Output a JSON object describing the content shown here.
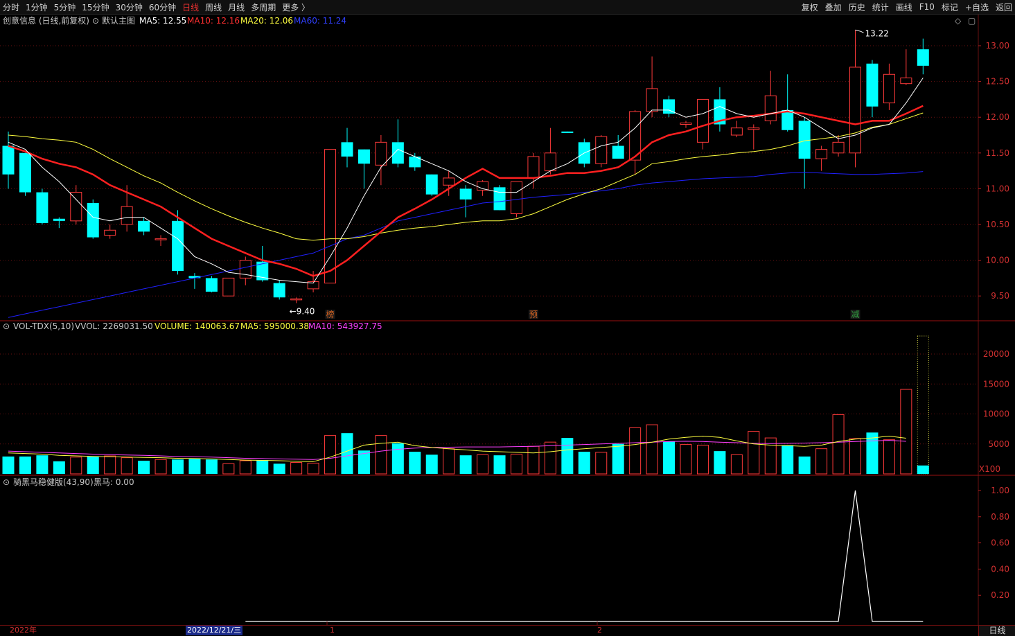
{
  "toolbar": {
    "period_tabs": [
      "分时",
      "1分钟",
      "5分钟",
      "15分钟",
      "30分钟",
      "60分钟",
      "日线",
      "周线",
      "月线",
      "多周期",
      "更多 〉"
    ],
    "active_index": 6,
    "tools": [
      "复权",
      "叠加",
      "历史",
      "统计",
      "画线",
      "F10",
      "标记",
      "+自选",
      "返回"
    ]
  },
  "main_panel": {
    "title": "创意信息 (日线,前复权)",
    "indicator": "默认主图",
    "ma5": "MA5: 12.55",
    "ma10": "MA10: 12.16",
    "ma20": "MA20: 12.06",
    "ma60": "MA60: 11.24",
    "high_label": "13.22",
    "low_label": "9.40",
    "price_ticks": [
      "13.00",
      "12.50",
      "12.00",
      "11.50",
      "11.00",
      "10.50",
      "10.00",
      "9.50"
    ],
    "markers": [
      {
        "text": "榜",
        "color": "#d06020"
      },
      {
        "text": "预",
        "color": "#d06020"
      },
      {
        "text": "减",
        "color": "#30a040"
      }
    ]
  },
  "volume_panel": {
    "title": "VOL-TDX(5,10)",
    "vvol": "VVOL: 2269031.50",
    "volume": "VOLUME: 140063.67",
    "ma5": "MA5: 595000.38",
    "ma10": "MA10: 543927.75",
    "ticks": [
      "20000",
      "15000",
      "10000",
      "5000"
    ],
    "unit": "X100"
  },
  "indicator_panel": {
    "title": "骑黑马稳健版(43,90)",
    "value": "黑马: 0.00",
    "ticks": [
      "1.00",
      "0.80",
      "0.60",
      "0.40",
      "0.20"
    ]
  },
  "bottom_axis": {
    "year": "2022年",
    "cursor_date": "2022/12/21/三",
    "month1": "1",
    "month2": "2",
    "period_button": "日线"
  },
  "colors": {
    "up": "#ff3a3a",
    "down": "#00ffff",
    "ma5": "#ffffff",
    "ma10": "#ff2020",
    "ma20": "#ffff40",
    "ma60": "#2020ff",
    "vol_ma10": "#ff40ff",
    "grid": "#6a1010"
  },
  "chart_data": {
    "type": "candlestick",
    "candles": [
      {
        "o": 11.6,
        "h": 11.8,
        "l": 11.0,
        "c": 11.2
      },
      {
        "o": 11.5,
        "h": 11.5,
        "l": 10.9,
        "c": 10.95
      },
      {
        "o": 10.95,
        "h": 11.0,
        "l": 10.5,
        "c": 10.52
      },
      {
        "o": 10.58,
        "h": 10.6,
        "l": 10.45,
        "c": 10.55
      },
      {
        "o": 10.55,
        "h": 11.05,
        "l": 10.5,
        "c": 10.95
      },
      {
        "o": 10.8,
        "h": 10.85,
        "l": 10.3,
        "c": 10.32
      },
      {
        "o": 10.35,
        "h": 10.5,
        "l": 10.3,
        "c": 10.42
      },
      {
        "o": 10.5,
        "h": 11.05,
        "l": 10.4,
        "c": 10.75
      },
      {
        "o": 10.55,
        "h": 10.6,
        "l": 10.35,
        "c": 10.4
      },
      {
        "o": 10.3,
        "h": 10.35,
        "l": 10.2,
        "c": 10.3
      },
      {
        "o": 10.55,
        "h": 10.7,
        "l": 9.8,
        "c": 9.85
      },
      {
        "o": 9.78,
        "h": 9.82,
        "l": 9.6,
        "c": 9.75
      },
      {
        "o": 9.75,
        "h": 9.78,
        "l": 9.55,
        "c": 9.56
      },
      {
        "o": 9.5,
        "h": 9.75,
        "l": 9.5,
        "c": 9.75
      },
      {
        "o": 9.75,
        "h": 10.05,
        "l": 9.65,
        "c": 10.0
      },
      {
        "o": 9.98,
        "h": 10.2,
        "l": 9.7,
        "c": 9.72
      },
      {
        "o": 9.68,
        "h": 9.72,
        "l": 9.45,
        "c": 9.48
      },
      {
        "o": 9.46,
        "h": 9.48,
        "l": 9.4,
        "c": 9.46
      },
      {
        "o": 9.6,
        "h": 9.85,
        "l": 9.55,
        "c": 9.7
      },
      {
        "o": 9.68,
        "h": 11.55,
        "l": 9.68,
        "c": 11.55
      },
      {
        "o": 11.65,
        "h": 11.85,
        "l": 11.3,
        "c": 11.45
      },
      {
        "o": 11.55,
        "h": 11.55,
        "l": 11.0,
        "c": 11.35
      },
      {
        "o": 11.33,
        "h": 11.75,
        "l": 11.05,
        "c": 11.65
      },
      {
        "o": 11.65,
        "h": 11.97,
        "l": 11.3,
        "c": 11.35
      },
      {
        "o": 11.45,
        "h": 11.5,
        "l": 11.25,
        "c": 11.3
      },
      {
        "o": 11.2,
        "h": 11.2,
        "l": 10.9,
        "c": 10.92
      },
      {
        "o": 11.05,
        "h": 11.25,
        "l": 10.9,
        "c": 11.15
      },
      {
        "o": 11.0,
        "h": 11.05,
        "l": 10.6,
        "c": 10.85
      },
      {
        "o": 10.98,
        "h": 11.12,
        "l": 10.9,
        "c": 11.1
      },
      {
        "o": 11.02,
        "h": 11.05,
        "l": 10.7,
        "c": 10.7
      },
      {
        "o": 10.65,
        "h": 11.1,
        "l": 10.6,
        "c": 11.1
      },
      {
        "o": 11.15,
        "h": 11.5,
        "l": 11.0,
        "c": 11.45
      },
      {
        "o": 11.25,
        "h": 11.85,
        "l": 11.2,
        "c": 11.5
      },
      {
        "o": 11.8,
        "h": 11.8,
        "l": 11.78,
        "c": 11.78
      },
      {
        "o": 11.65,
        "h": 11.7,
        "l": 11.3,
        "c": 11.35
      },
      {
        "o": 11.35,
        "h": 11.75,
        "l": 11.3,
        "c": 11.73
      },
      {
        "o": 11.6,
        "h": 11.75,
        "l": 11.45,
        "c": 11.42
      },
      {
        "o": 11.4,
        "h": 12.1,
        "l": 11.2,
        "c": 12.08
      },
      {
        "o": 12.08,
        "h": 12.85,
        "l": 12.0,
        "c": 12.4
      },
      {
        "o": 12.25,
        "h": 12.3,
        "l": 12.0,
        "c": 12.05
      },
      {
        "o": 11.9,
        "h": 11.95,
        "l": 11.85,
        "c": 11.92
      },
      {
        "o": 11.65,
        "h": 12.25,
        "l": 11.55,
        "c": 12.25
      },
      {
        "o": 12.25,
        "h": 12.42,
        "l": 11.8,
        "c": 11.9
      },
      {
        "o": 11.75,
        "h": 11.95,
        "l": 11.72,
        "c": 11.85
      },
      {
        "o": 11.83,
        "h": 11.9,
        "l": 11.55,
        "c": 11.85
      },
      {
        "o": 11.95,
        "h": 12.65,
        "l": 11.9,
        "c": 12.3
      },
      {
        "o": 12.1,
        "h": 12.6,
        "l": 11.8,
        "c": 11.82
      },
      {
        "o": 11.95,
        "h": 12.0,
        "l": 11.0,
        "c": 11.42
      },
      {
        "o": 11.42,
        "h": 11.6,
        "l": 11.25,
        "c": 11.55
      },
      {
        "o": 11.5,
        "h": 11.75,
        "l": 11.45,
        "c": 11.65
      },
      {
        "o": 11.5,
        "h": 13.22,
        "l": 11.3,
        "c": 12.7
      },
      {
        "o": 12.75,
        "h": 12.8,
        "l": 12.0,
        "c": 12.15
      },
      {
        "o": 12.2,
        "h": 12.75,
        "l": 12.1,
        "c": 12.6
      },
      {
        "o": 12.47,
        "h": 12.95,
        "l": 12.45,
        "c": 12.55
      },
      {
        "o": 12.95,
        "h": 13.1,
        "l": 12.6,
        "c": 12.72
      }
    ],
    "ma5": [
      11.65,
      11.55,
      11.3,
      11.1,
      10.85,
      10.6,
      10.55,
      10.6,
      10.6,
      10.45,
      10.3,
      10.05,
      9.95,
      9.83,
      9.8,
      9.76,
      9.72,
      9.7,
      9.68,
      10.05,
      10.45,
      10.9,
      11.3,
      11.55,
      11.45,
      11.35,
      11.25,
      11.1,
      11.0,
      10.95,
      10.95,
      11.1,
      11.25,
      11.35,
      11.5,
      11.6,
      11.65,
      11.85,
      12.1,
      12.1,
      12.0,
      12.05,
      12.15,
      12.05,
      12.0,
      12.05,
      12.1,
      12.0,
      11.85,
      11.7,
      11.75,
      11.85,
      11.9,
      12.2,
      12.55
    ],
    "ma10": [
      11.6,
      11.52,
      11.42,
      11.35,
      11.3,
      11.2,
      11.05,
      10.95,
      10.85,
      10.75,
      10.6,
      10.45,
      10.3,
      10.2,
      10.1,
      10.0,
      9.95,
      9.88,
      9.78,
      9.85,
      10.0,
      10.2,
      10.4,
      10.6,
      10.72,
      10.85,
      11.0,
      11.15,
      11.28,
      11.15,
      11.15,
      11.15,
      11.18,
      11.22,
      11.22,
      11.25,
      11.3,
      11.45,
      11.65,
      11.75,
      11.8,
      11.88,
      11.95,
      12.0,
      12.02,
      12.05,
      12.08,
      12.05,
      12.0,
      11.95,
      11.9,
      11.95,
      11.95,
      12.05,
      12.16
    ],
    "ma20": [
      11.75,
      11.73,
      11.7,
      11.68,
      11.65,
      11.55,
      11.42,
      11.3,
      11.18,
      11.08,
      10.95,
      10.83,
      10.72,
      10.62,
      10.53,
      10.45,
      10.38,
      10.3,
      10.28,
      10.3,
      10.3,
      10.33,
      10.38,
      10.42,
      10.45,
      10.47,
      10.5,
      10.53,
      10.55,
      10.55,
      10.58,
      10.65,
      10.75,
      10.85,
      10.93,
      11.0,
      11.1,
      11.2,
      11.35,
      11.38,
      11.42,
      11.45,
      11.47,
      11.5,
      11.52,
      11.55,
      11.6,
      11.67,
      11.7,
      11.73,
      11.78,
      11.86,
      11.9,
      11.98,
      12.06
    ],
    "ma60": [
      9.2,
      9.25,
      9.3,
      9.35,
      9.4,
      9.45,
      9.5,
      9.55,
      9.6,
      9.65,
      9.7,
      9.75,
      9.8,
      9.85,
      9.9,
      9.95,
      10.0,
      10.05,
      10.1,
      10.2,
      10.3,
      10.35,
      10.45,
      10.55,
      10.6,
      10.65,
      10.7,
      10.75,
      10.8,
      10.82,
      10.85,
      10.88,
      10.9,
      10.92,
      10.95,
      10.97,
      11.0,
      11.05,
      11.08,
      11.1,
      11.12,
      11.14,
      11.15,
      11.16,
      11.17,
      11.2,
      11.22,
      11.23,
      11.22,
      11.21,
      11.2,
      11.2,
      11.21,
      11.22,
      11.24
    ],
    "volume": [
      2900,
      2900,
      3100,
      2100,
      2800,
      2900,
      3000,
      2700,
      2200,
      2400,
      2400,
      2500,
      2400,
      1700,
      2200,
      2300,
      1700,
      1900,
      1800,
      6400,
      6800,
      3900,
      6400,
      5100,
      3700,
      3200,
      4200,
      3100,
      3200,
      3100,
      3300,
      4600,
      5300,
      6000,
      3700,
      3600,
      5000,
      7700,
      8200,
      5400,
      4900,
      4800,
      3800,
      3200,
      7100,
      6000,
      4800,
      2900,
      4200,
      9900,
      5900,
      6900,
      5700,
      14100
    ],
    "vol_ma5": [
      3500,
      3400,
      3300,
      3100,
      3000,
      2900,
      2850,
      2800,
      2750,
      2700,
      2600,
      2550,
      2500,
      2400,
      2300,
      2250,
      2200,
      2100,
      2050,
      2800,
      3800,
      4800,
      5100,
      5300,
      4700,
      4400,
      4200,
      4000,
      3800,
      3700,
      3600,
      3500,
      3700,
      4000,
      4200,
      4400,
      4600,
      4900,
      5300,
      5800,
      6100,
      6300,
      6100,
      5500,
      5000,
      4800,
      4700,
      4600,
      4800,
      5400,
      5800,
      6000,
      6300,
      5950
    ],
    "vol_ma10": [
      3800,
      3700,
      3600,
      3500,
      3400,
      3300,
      3200,
      3150,
      3100,
      3000,
      2900,
      2850,
      2800,
      2700,
      2600,
      2550,
      2500,
      2450,
      2400,
      2600,
      3000,
      3400,
      3800,
      4100,
      4300,
      4400,
      4450,
      4500,
      4500,
      4500,
      4550,
      4600,
      4700,
      4800,
      4900,
      5000,
      5100,
      5200,
      5300,
      5400,
      5450,
      5400,
      5300,
      5200,
      5100,
      5050,
      5100,
      5150,
      5200,
      5300,
      5400,
      5500,
      5600,
      5439
    ]
  },
  "indicator_data": {
    "signal_index": 50,
    "start_index": 14
  }
}
